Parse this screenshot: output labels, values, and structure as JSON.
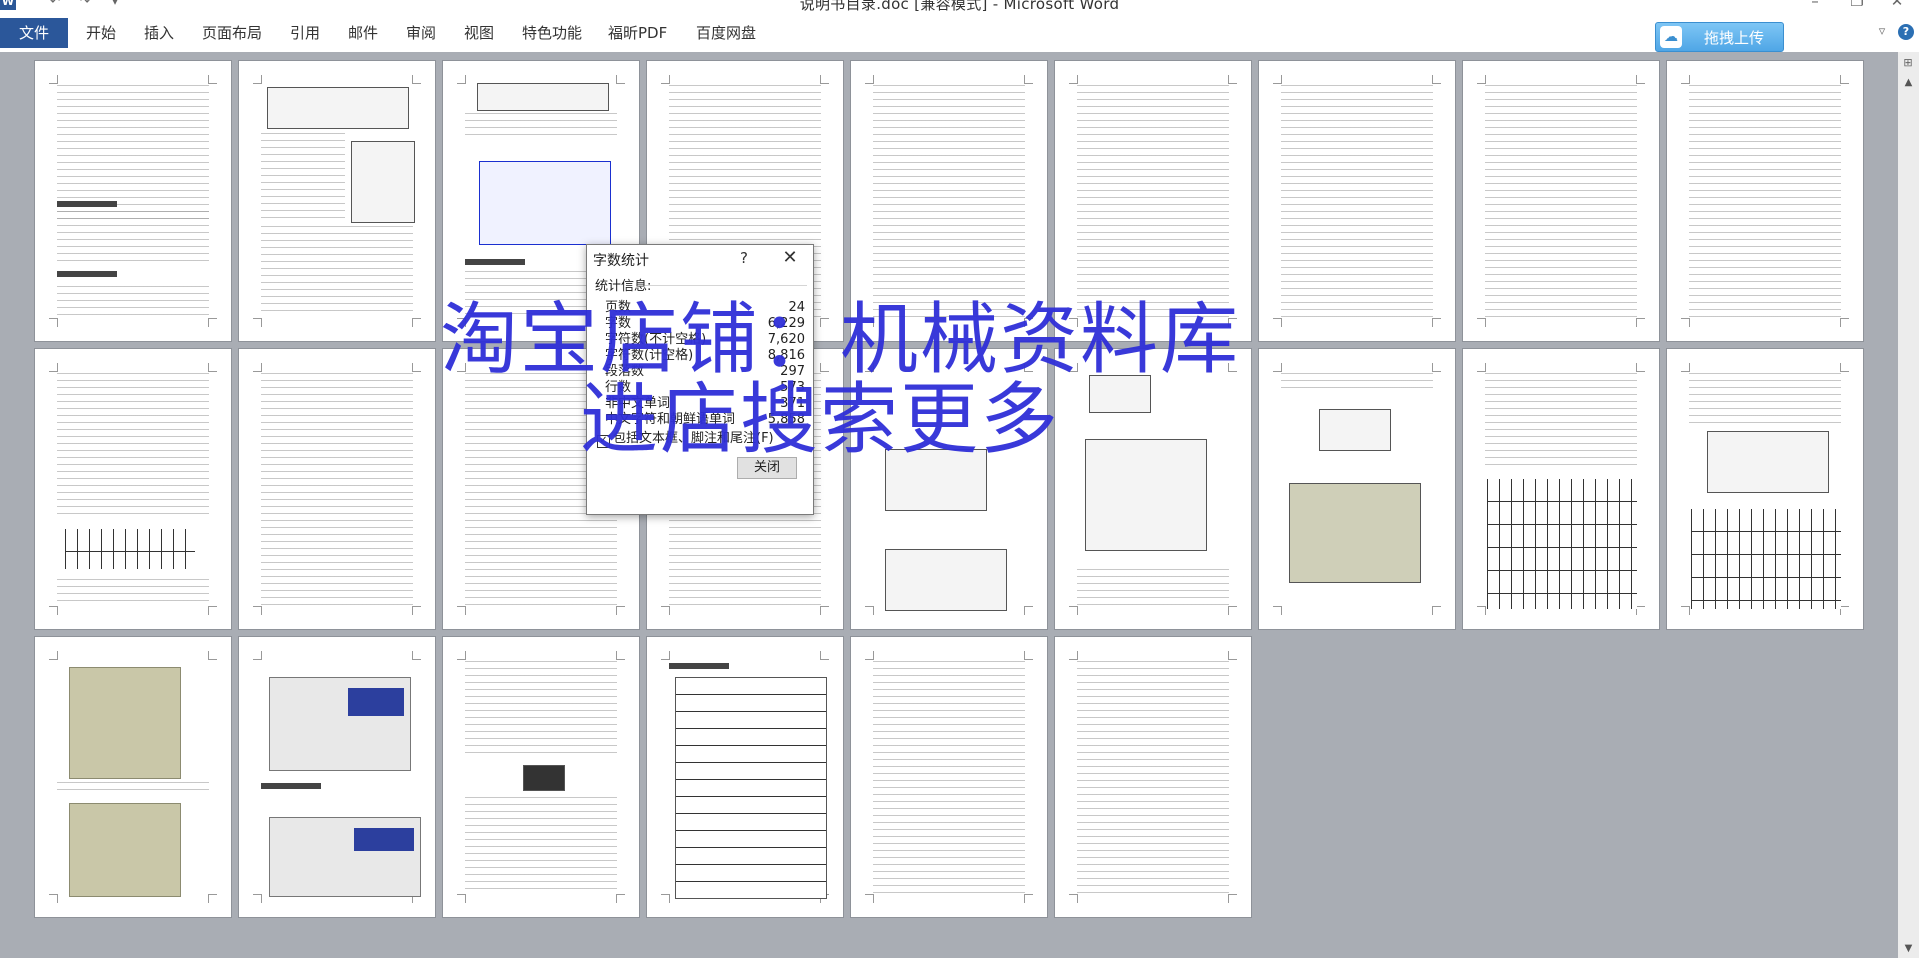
{
  "window": {
    "title": "说明书目录.doc [兼容模式] - Microsoft Word",
    "app_icon_letter": "W",
    "minimize_glyph": "–",
    "restore_glyph": "❐",
    "close_glyph": "✕"
  },
  "ribbon": {
    "tabs": [
      "文件",
      "开始",
      "插入",
      "页面布局",
      "引用",
      "邮件",
      "审阅",
      "视图",
      "特色功能",
      "福昕PDF",
      "百度网盘"
    ],
    "upload_button": "拖拽上传",
    "collapse_glyph": "▿",
    "help_glyph": "?"
  },
  "dialog": {
    "title": "字数统计",
    "help_glyph": "?",
    "close_glyph": "✕",
    "section_label": "统计信息:",
    "stats": [
      {
        "label": "页数",
        "value": "24"
      },
      {
        "label": "字数",
        "value": "6,229"
      },
      {
        "label": "字符数(不计空格)",
        "value": "7,620"
      },
      {
        "label": "字符数(计空格)",
        "value": "8,816"
      },
      {
        "label": "段落数",
        "value": "297"
      },
      {
        "label": "行数",
        "value": "573"
      },
      {
        "label": "非中文单词",
        "value": "371"
      },
      {
        "label": "中文字符和朝鲜语单词",
        "value": "5,858"
      }
    ],
    "checkbox_label": "包括文本框、脚注和尾注(F)",
    "checkbox_checked": true,
    "close_button": "关闭"
  },
  "watermark": {
    "line1": "淘宝店铺：机械资料库",
    "line2": "进店搜索更多",
    "color": "#2f2fd8"
  },
  "scrollbar": {
    "up_glyph": "▲",
    "down_glyph": "▼"
  }
}
